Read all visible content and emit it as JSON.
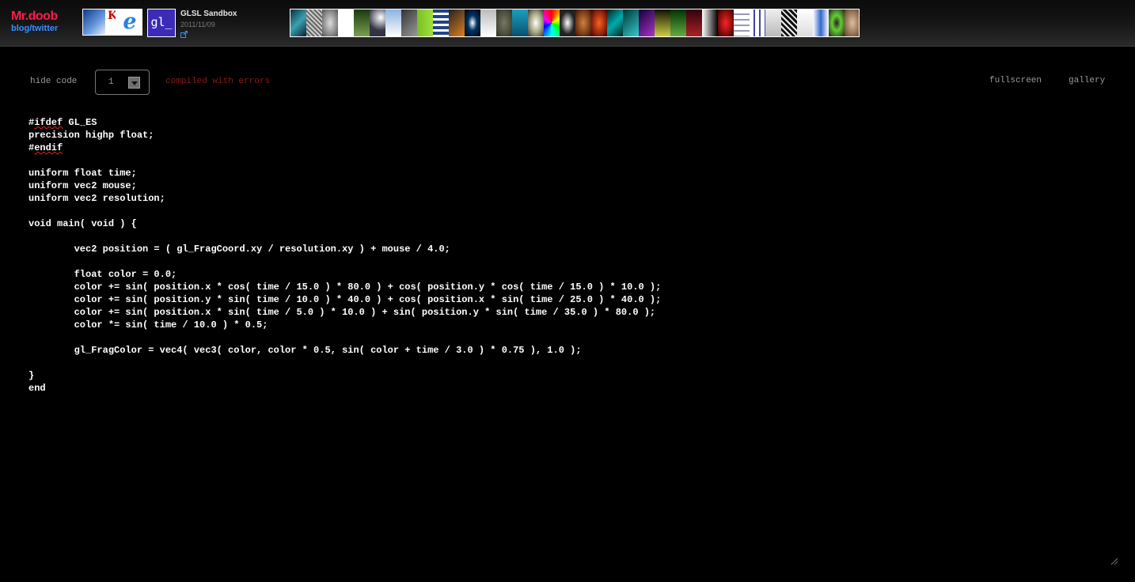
{
  "brand": {
    "name": "Mr.doob",
    "links": "blog/twitter"
  },
  "app": {
    "icon_text": "gl_",
    "title": "GLSL Sandbox",
    "date": "2011/11/09"
  },
  "toolbar": {
    "hide_code": "hide code",
    "quality": "1",
    "status": "compiled with errors",
    "fullscreen": "fullscreen",
    "gallery": "gallery"
  },
  "icons": {
    "external_link": "external-link-icon",
    "dropdown": "chevron-down-icon",
    "resize": "resize-handle-icon"
  },
  "colors": {
    "brand": "#ff1a4a",
    "links": "#3a8dff",
    "error": "#8b1a1a",
    "text": "#ffffff",
    "muted": "#9a9a9a"
  },
  "code": {
    "lines": [
      "#ifdef GL_ES",
      "precision highp float;",
      "#endif",
      "",
      "uniform float time;",
      "uniform vec2 mouse;",
      "uniform vec2 resolution;",
      "",
      "void main( void ) {",
      "",
      "        vec2 position = ( gl_FragCoord.xy / resolution.xy ) + mouse / 4.0;",
      "",
      "        float color = 0.0;",
      "        color += sin( position.x * cos( time / 15.0 ) * 80.0 ) + cos( position.y * cos( time / 15.0 ) * 10.0 );",
      "        color += sin( position.y * sin( time / 10.0 ) * 40.0 ) + cos( position.x * sin( time / 25.0 ) * 40.0 );",
      "        color += sin( position.x * sin( time / 5.0 ) * 10.0 ) + sin( position.y * sin( time / 35.0 ) * 80.0 );",
      "        color *= sin( time / 10.0 ) * 0.5;",
      "",
      "        gl_FragColor = vec4( vec3( color, color * 0.5, sin( color + time / 3.0 ) * 0.75 ), 1.0 );",
      "",
      "}",
      "end"
    ]
  }
}
